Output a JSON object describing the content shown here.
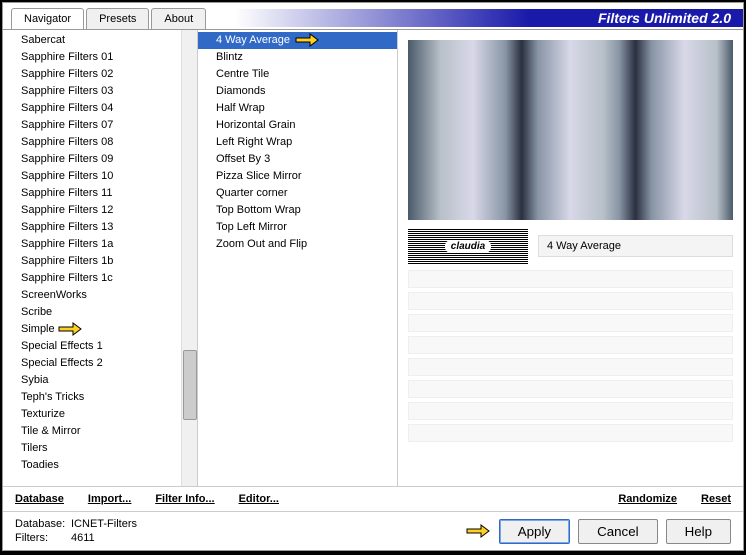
{
  "app": {
    "title": "Filters Unlimited 2.0"
  },
  "tabs": [
    {
      "label": "Navigator",
      "active": true
    },
    {
      "label": "Presets",
      "active": false
    },
    {
      "label": "About",
      "active": false
    }
  ],
  "categories": [
    "Sabercat",
    "Sapphire Filters 01",
    "Sapphire Filters 02",
    "Sapphire Filters 03",
    "Sapphire Filters 04",
    "Sapphire Filters 07",
    "Sapphire Filters 08",
    "Sapphire Filters 09",
    "Sapphire Filters 10",
    "Sapphire Filters 11",
    "Sapphire Filters 12",
    "Sapphire Filters 13",
    "Sapphire Filters 1a",
    "Sapphire Filters 1b",
    "Sapphire Filters 1c",
    "ScreenWorks",
    "Scribe",
    "Simple",
    "Special Effects 1",
    "Special Effects 2",
    "Sybia",
    "Teph's Tricks",
    "Texturize",
    "Tile & Mirror",
    "Tilers",
    "Toadies"
  ],
  "category_highlight": "Simple",
  "filters": [
    "4 Way Average",
    "Blintz",
    "Centre Tile",
    "Diamonds",
    "Half Wrap",
    "Horizontal Grain",
    "Left Right Wrap",
    "Offset By 3",
    "Pizza Slice Mirror",
    "Quarter corner",
    "Top Bottom Wrap",
    "Top Left Mirror",
    "Zoom Out and Flip"
  ],
  "filter_selected": "4 Way Average",
  "logo_text": "claudia",
  "current_filter_label": "4 Way Average",
  "toolbar": {
    "database": "Database",
    "import": "Import...",
    "filterinfo": "Filter Info...",
    "editor": "Editor...",
    "randomize": "Randomize",
    "reset": "Reset"
  },
  "status": {
    "db_label": "Database:",
    "db_value": "ICNET-Filters",
    "filters_label": "Filters:",
    "filters_value": "4611"
  },
  "buttons": {
    "apply": "Apply",
    "cancel": "Cancel",
    "help": "Help"
  }
}
